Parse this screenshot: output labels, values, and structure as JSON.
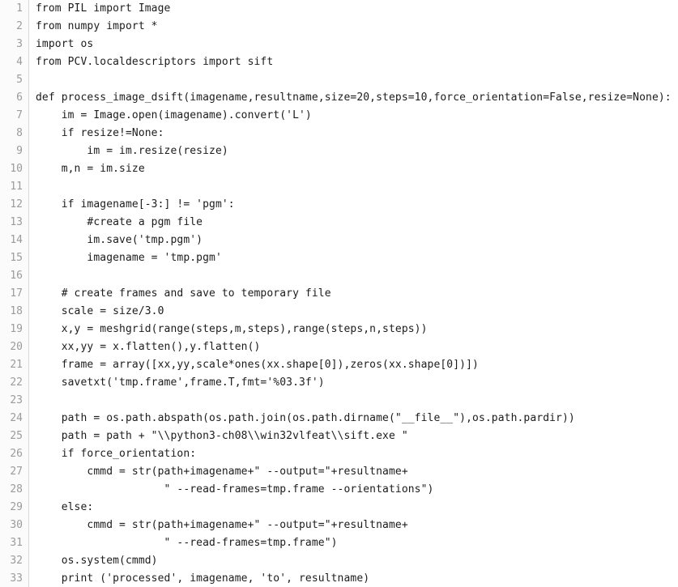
{
  "editor": {
    "language": "python",
    "total_lines": 33,
    "background_color": "#ffffff",
    "gutter_color": "#fbfbfb",
    "gutter_border_color": "#d8d8d8",
    "line_number_color": "#9b9b9b",
    "text_color": "#1c1c1c",
    "first_visible_line": 1,
    "last_visible_line": 33
  },
  "lines": [
    {
      "n": "1",
      "text": "from PIL import Image"
    },
    {
      "n": "2",
      "text": "from numpy import *"
    },
    {
      "n": "3",
      "text": "import os"
    },
    {
      "n": "4",
      "text": "from PCV.localdescriptors import sift"
    },
    {
      "n": "5",
      "text": ""
    },
    {
      "n": "6",
      "text": "def process_image_dsift(imagename,resultname,size=20,steps=10,force_orientation=False,resize=None):"
    },
    {
      "n": "7",
      "text": "    im = Image.open(imagename).convert('L')"
    },
    {
      "n": "8",
      "text": "    if resize!=None:"
    },
    {
      "n": "9",
      "text": "        im = im.resize(resize)"
    },
    {
      "n": "10",
      "text": "    m,n = im.size"
    },
    {
      "n": "11",
      "text": ""
    },
    {
      "n": "12",
      "text": "    if imagename[-3:] != 'pgm':"
    },
    {
      "n": "13",
      "text": "        #create a pgm file"
    },
    {
      "n": "14",
      "text": "        im.save('tmp.pgm')"
    },
    {
      "n": "15",
      "text": "        imagename = 'tmp.pgm'"
    },
    {
      "n": "16",
      "text": ""
    },
    {
      "n": "17",
      "text": "    # create frames and save to temporary file"
    },
    {
      "n": "18",
      "text": "    scale = size/3.0"
    },
    {
      "n": "19",
      "text": "    x,y = meshgrid(range(steps,m,steps),range(steps,n,steps))"
    },
    {
      "n": "20",
      "text": "    xx,yy = x.flatten(),y.flatten()"
    },
    {
      "n": "21",
      "text": "    frame = array([xx,yy,scale*ones(xx.shape[0]),zeros(xx.shape[0])])"
    },
    {
      "n": "22",
      "text": "    savetxt('tmp.frame',frame.T,fmt='%03.3f')"
    },
    {
      "n": "23",
      "text": ""
    },
    {
      "n": "24",
      "text": "    path = os.path.abspath(os.path.join(os.path.dirname(\"__file__\"),os.path.pardir))"
    },
    {
      "n": "25",
      "text": "    path = path + \"\\\\python3-ch08\\\\win32vlfeat\\\\sift.exe \""
    },
    {
      "n": "26",
      "text": "    if force_orientation:"
    },
    {
      "n": "27",
      "text": "        cmmd = str(path+imagename+\" --output=\"+resultname+"
    },
    {
      "n": "28",
      "text": "                    \" --read-frames=tmp.frame --orientations\")"
    },
    {
      "n": "29",
      "text": "    else:"
    },
    {
      "n": "30",
      "text": "        cmmd = str(path+imagename+\" --output=\"+resultname+"
    },
    {
      "n": "31",
      "text": "                    \" --read-frames=tmp.frame\")"
    },
    {
      "n": "32",
      "text": "    os.system(cmmd)"
    },
    {
      "n": "33",
      "text": "    print ('processed', imagename, 'to', resultname)"
    }
  ]
}
